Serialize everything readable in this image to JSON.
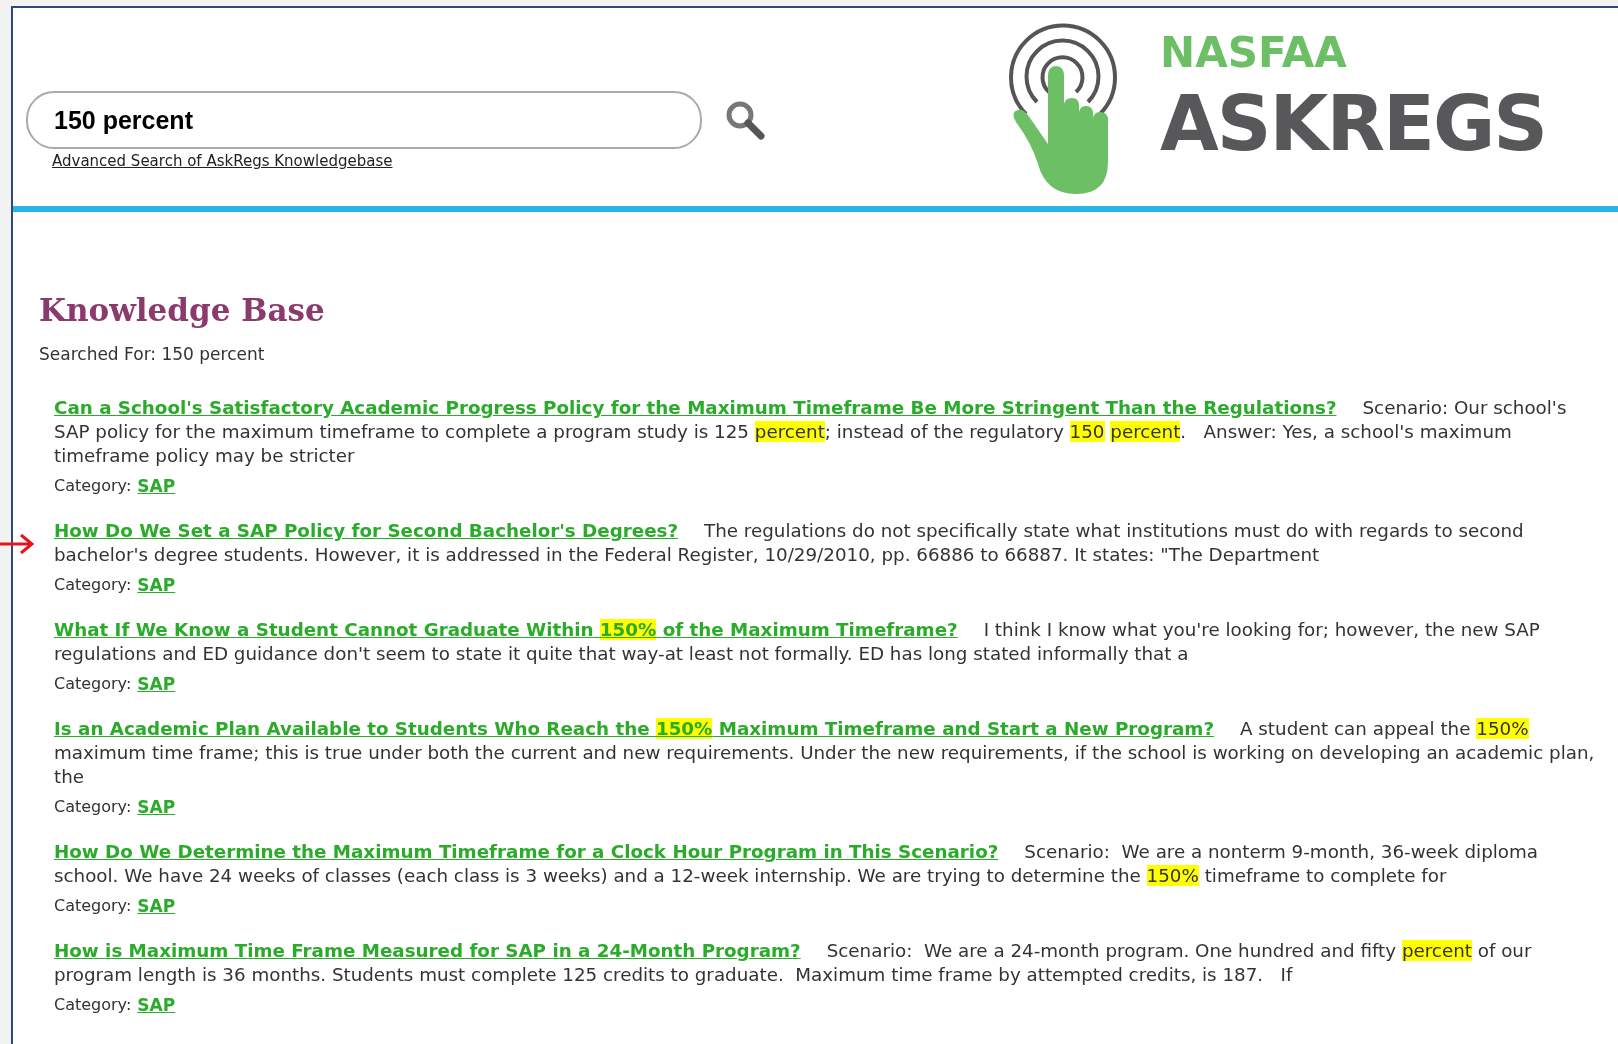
{
  "search": {
    "value": "150 percent",
    "advanced_link": "Advanced Search of AskRegs Knowledgebase"
  },
  "logo": {
    "top": "NASFAA",
    "main": "ASKREGS"
  },
  "heading": "Knowledge Base",
  "searched_for": "Searched For: 150 percent",
  "results": [
    {
      "marked": false,
      "title": [
        {
          "text": "Can a School's Satisfactory Academic Progress Policy for the Maximum Timeframe Be More Stringent Than the Regulations?",
          "highlight": false
        }
      ],
      "snippet": [
        {
          "text": "Scenario: Our school's SAP policy for the maximum timeframe to complete a program study is 125 ",
          "highlight": false
        },
        {
          "text": "percent",
          "highlight": true
        },
        {
          "text": "; instead of the regulatory ",
          "highlight": false
        },
        {
          "text": "150",
          "highlight": true
        },
        {
          "text": " percent",
          "highlight": true
        },
        {
          "text": ".   Answer: Yes, a school's maximum timeframe policy may be stricter",
          "highlight": false
        }
      ],
      "category_label": "Category:",
      "category": "SAP"
    },
    {
      "marked": true,
      "title": [
        {
          "text": "How Do We Set a SAP Policy for Second Bachelor's Degrees?",
          "highlight": false
        }
      ],
      "snippet": [
        {
          "text": "The regulations do not specifically state what institutions must do with regards to second bachelor's degree students. However, it is addressed in the Federal Register, 10/29/2010, pp. 66886 to 66887. It states: \"The Department",
          "highlight": false
        }
      ],
      "category_label": "Category:",
      "category": "SAP"
    },
    {
      "marked": false,
      "title": [
        {
          "text": "What If We Know a Student Cannot Graduate Within ",
          "highlight": false
        },
        {
          "text": "150%",
          "highlight": true
        },
        {
          "text": " of the Maximum Timeframe?",
          "highlight": false
        }
      ],
      "snippet": [
        {
          "text": "I think I know what you're looking for; however, the new SAP regulations and ED guidance don't seem to state it quite that way-at least not formally. ED has long stated informally that a",
          "highlight": false
        }
      ],
      "category_label": "Category:",
      "category": "SAP"
    },
    {
      "marked": false,
      "title": [
        {
          "text": "Is an Academic Plan Available to Students Who Reach the ",
          "highlight": false
        },
        {
          "text": "150%",
          "highlight": true
        },
        {
          "text": " Maximum Timeframe and Start a New Program?",
          "highlight": false
        }
      ],
      "snippet": [
        {
          "text": "A student can appeal the ",
          "highlight": false
        },
        {
          "text": "150%",
          "highlight": true
        },
        {
          "text": " maximum time frame; this is true under both the current and new requirements. Under the new requirements, if the school is working on developing an academic plan, the",
          "highlight": false
        }
      ],
      "category_label": "Category:",
      "category": "SAP"
    },
    {
      "marked": false,
      "title": [
        {
          "text": "How Do We Determine the Maximum Timeframe for a Clock Hour Program in This Scenario?",
          "highlight": false
        }
      ],
      "snippet": [
        {
          "text": "Scenario:  We are a nonterm 9-month, 36-week diploma school. We have 24 weeks of classes (each class is 3 weeks) and a 12-week internship. We are trying to determine the ",
          "highlight": false
        },
        {
          "text": "150%",
          "highlight": true
        },
        {
          "text": " timeframe to complete for",
          "highlight": false
        }
      ],
      "category_label": "Category:",
      "category": "SAP"
    },
    {
      "marked": false,
      "title": [
        {
          "text": "How is Maximum Time Frame Measured for SAP in a 24-Month Program?",
          "highlight": false
        }
      ],
      "snippet": [
        {
          "text": "Scenario:  We are a 24-month program. One hundred and fifty ",
          "highlight": false
        },
        {
          "text": "percent",
          "highlight": true
        },
        {
          "text": " of our program length is 36 months. Students must complete 125 credits to graduate.  Maximum time frame by attempted credits, is 187.   If",
          "highlight": false
        }
      ],
      "category_label": "Category:",
      "category": "SAP"
    }
  ]
}
